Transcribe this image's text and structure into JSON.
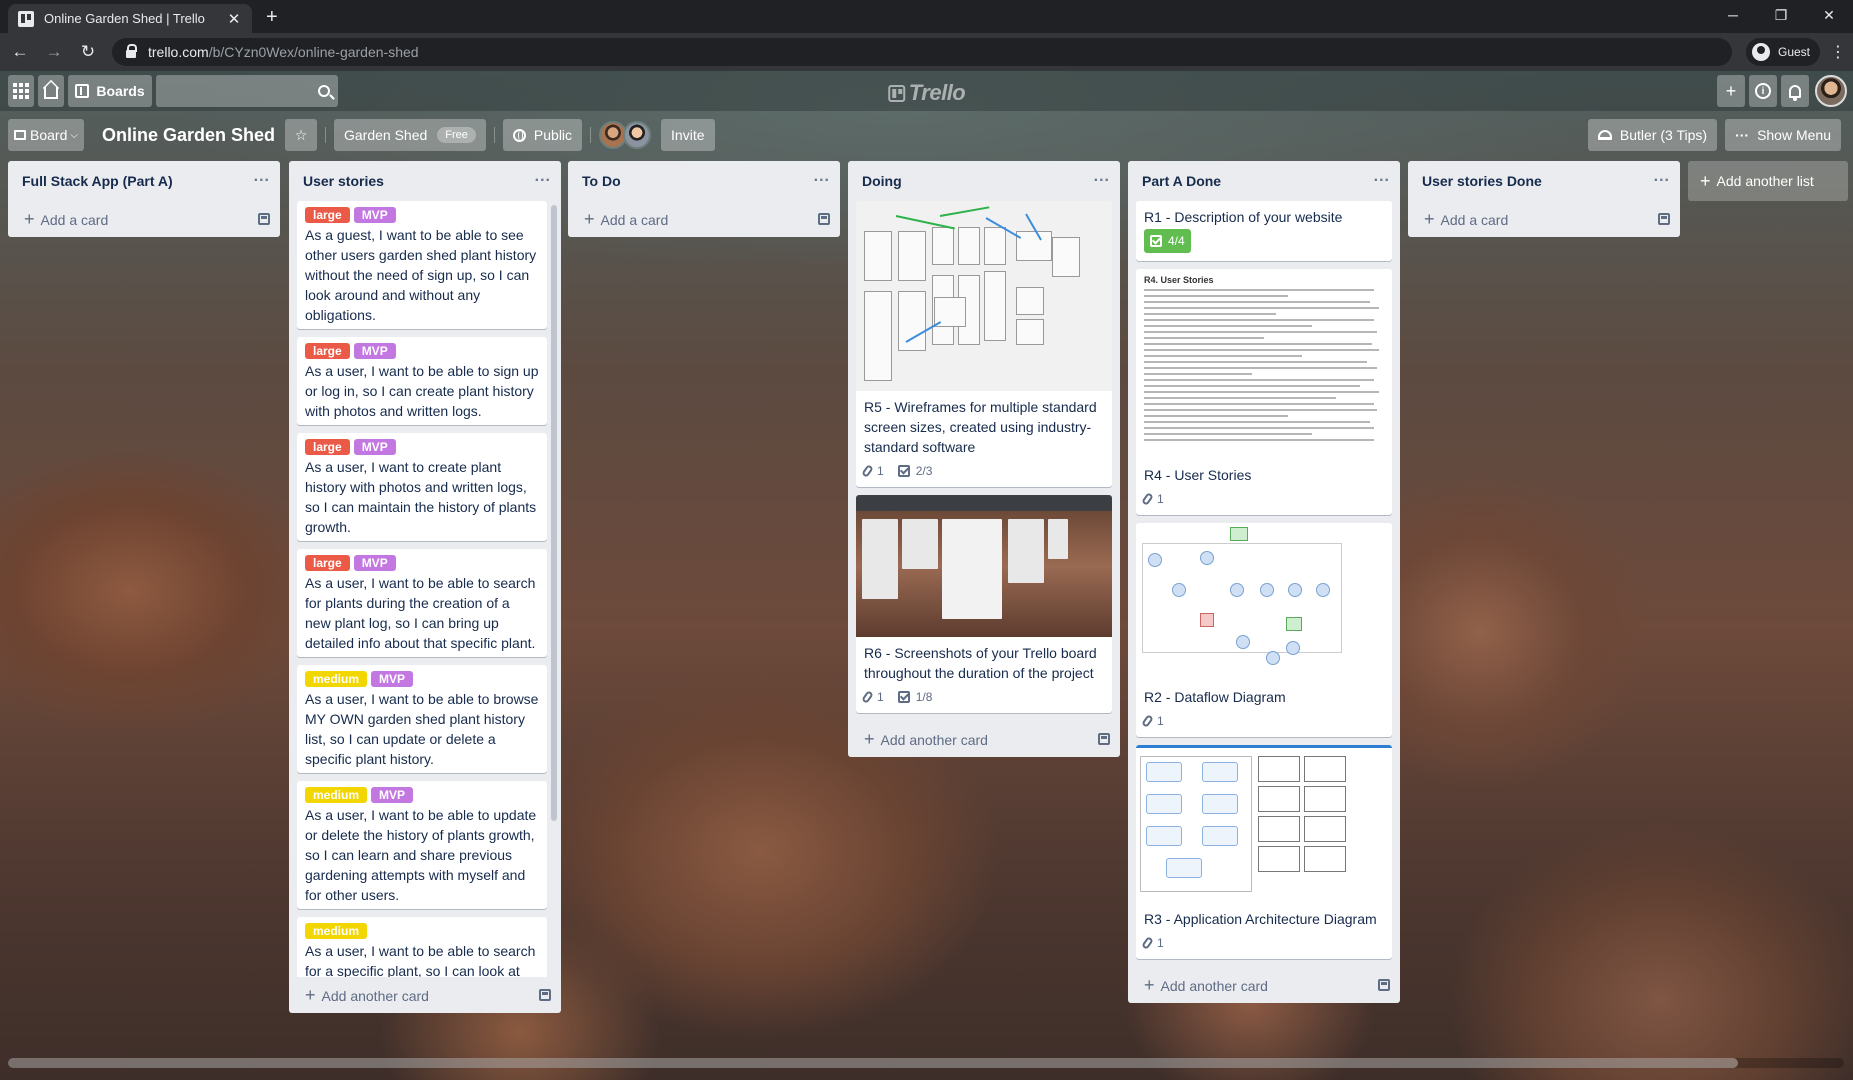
{
  "browser": {
    "tab_title": "Online Garden Shed | Trello",
    "url_host": "trello.com",
    "url_path": "/b/CYzn0Wex/online-garden-shed",
    "profile_label": "Guest"
  },
  "topnav": {
    "boards_label": "Boards",
    "search_placeholder": "",
    "logo_text": "Trello"
  },
  "board": {
    "switcher_label": "Board",
    "name": "Online Garden Shed",
    "team_label": "Garden Shed",
    "team_badge": "Free",
    "visibility": "Public",
    "invite_label": "Invite",
    "butler_label": "Butler (3 Tips)",
    "menu_label": "Show Menu"
  },
  "colors": {
    "label_large": "#eb5a46",
    "label_mvp": "#c377e0",
    "label_medium": "#f2d600",
    "checklist_done": "#61bd4f",
    "list_bg": "#ebecf0"
  },
  "lists": [
    {
      "title": "Full Stack App (Part A)",
      "add_card": "Add a card",
      "cards": []
    },
    {
      "title": "User stories",
      "add_card": "Add another card",
      "cards": [
        {
          "labels": [
            "large",
            "MVP"
          ],
          "text": "As a guest, I want to be able to see other users garden shed plant history without the need of sign up, so I can look around and without any obligations."
        },
        {
          "labels": [
            "large",
            "MVP"
          ],
          "text": "As a user, I want to be able to sign up or log in, so I can create plant history with photos and written logs."
        },
        {
          "labels": [
            "large",
            "MVP"
          ],
          "text": "As a user, I want to create plant history with photos and written logs, so I can maintain the history of plants growth."
        },
        {
          "labels": [
            "large",
            "MVP"
          ],
          "text": "As a user, I want to be able to search for plants during the creation of a new plant log, so I can bring up detailed info about that specific plant."
        },
        {
          "labels": [
            "medium",
            "MVP"
          ],
          "text": "As a user, I want to be able to browse MY OWN garden shed plant history list, so I can update or delete a specific plant history."
        },
        {
          "labels": [
            "medium",
            "MVP"
          ],
          "text": "As a user, I want to be able to update or delete the history of plants growth, so I can learn and share previous gardening attempts with myself and for other users."
        },
        {
          "labels": [
            "medium"
          ],
          "text": "As a user, I want to be able to search for a specific plant, so I can look at the"
        }
      ]
    },
    {
      "title": "To Do",
      "add_card": "Add a card",
      "cards": []
    },
    {
      "title": "Doing",
      "add_card": "Add another card",
      "cards": [
        {
          "text": "R5 - Wireframes for multiple standard screen sizes, created using industry-standard software",
          "attachments": "1",
          "checklist": "2/3"
        },
        {
          "text": "R6 - Screenshots of your Trello board throughout the duration of the project",
          "attachments": "1",
          "checklist": "1/8"
        }
      ]
    },
    {
      "title": "Part A Done",
      "add_card": "Add another card",
      "cards": [
        {
          "text": "R1 - Description of your website",
          "checklist": "4/4"
        },
        {
          "text": "R4 - User Stories",
          "attachments": "1",
          "cover_title": "R4. User Stories"
        },
        {
          "text": "R2 - Dataflow Diagram",
          "attachments": "1"
        },
        {
          "text": "R3 - Application Architecture Diagram",
          "attachments": "1"
        }
      ]
    },
    {
      "title": "User stories Done",
      "add_card": "Add a card",
      "cards": []
    }
  ],
  "add_list_label": "Add another list"
}
